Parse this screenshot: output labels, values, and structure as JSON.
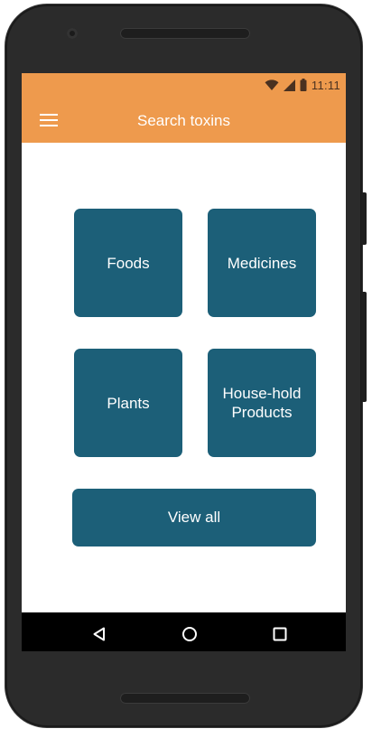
{
  "status_bar": {
    "time": "11:11",
    "icons": [
      "wifi-icon",
      "cell-signal-icon",
      "battery-icon"
    ]
  },
  "app_bar": {
    "title": "Search toxins",
    "menu_icon": "hamburger-menu-icon",
    "background": "#ee9a4d"
  },
  "categories": [
    {
      "label": "Foods"
    },
    {
      "label": "Medicines"
    },
    {
      "label": "Plants"
    },
    {
      "label": "House-hold Products"
    }
  ],
  "view_all_label": "View all",
  "tile_color": "#1c5f78",
  "nav_bar": {
    "icons": [
      "back-icon",
      "home-icon",
      "recents-icon"
    ]
  }
}
